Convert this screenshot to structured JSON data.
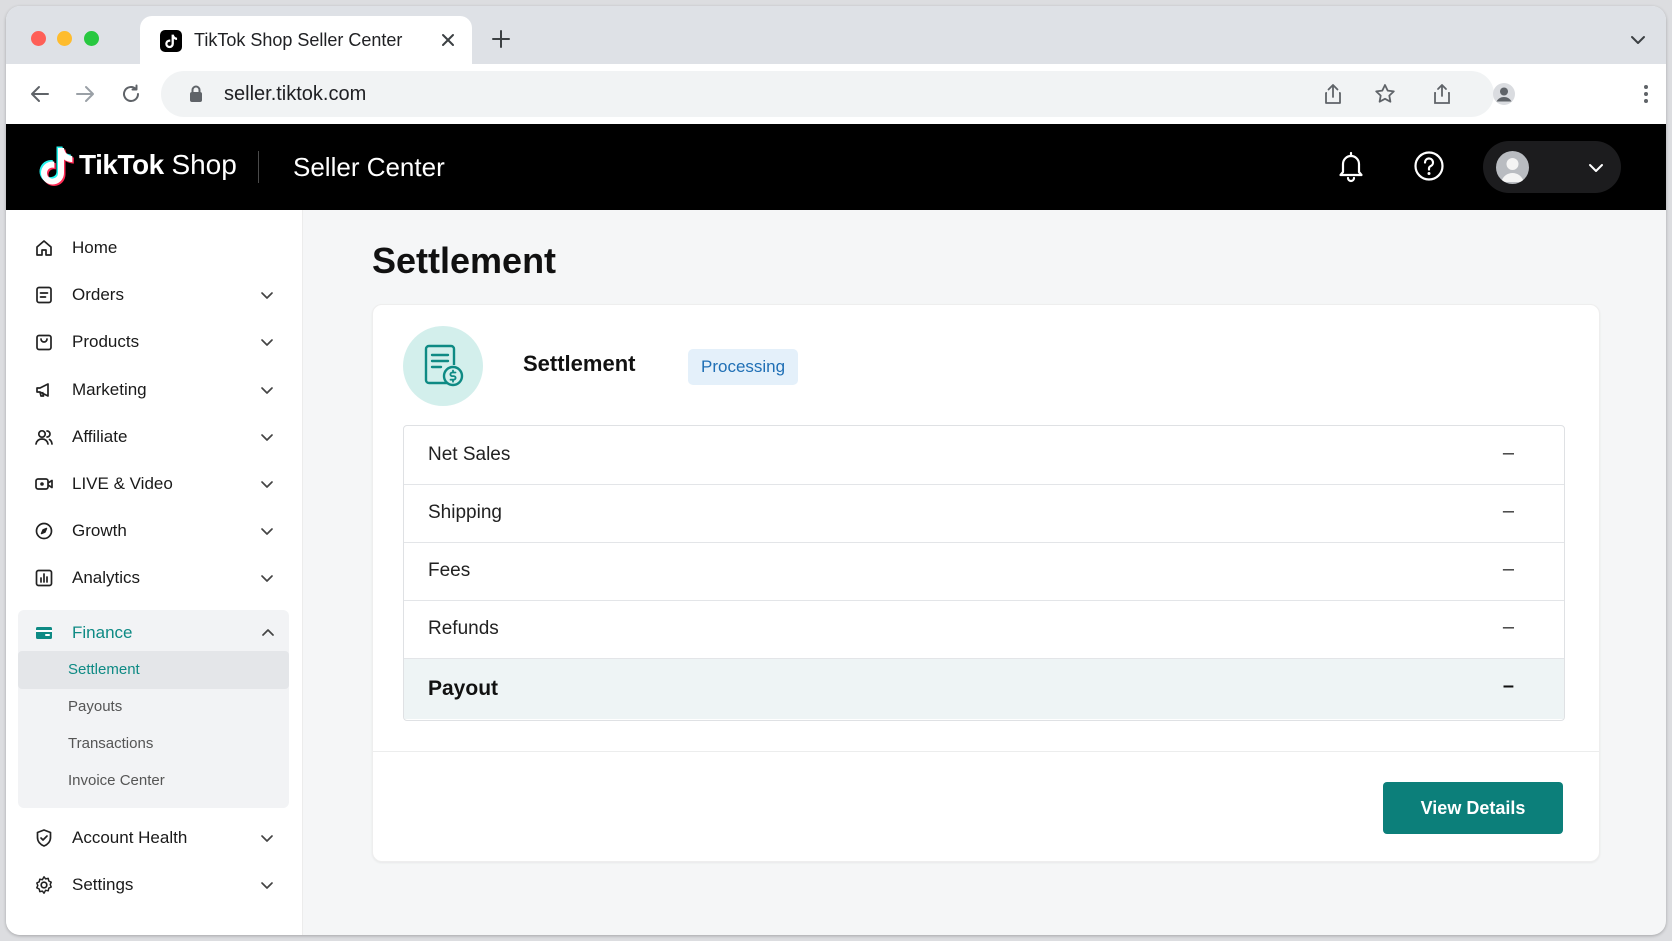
{
  "browser": {
    "tab_title": "TikTok Shop Seller Center",
    "url": "seller.tiktok.com"
  },
  "header": {
    "brand_bold": "TikTok",
    "brand_light": "Shop",
    "title": "Seller Center"
  },
  "sidebar": {
    "items": [
      {
        "label": "Home",
        "icon": "home-icon"
      },
      {
        "label": "Orders",
        "icon": "orders-icon"
      },
      {
        "label": "Products",
        "icon": "products-icon"
      },
      {
        "label": "Marketing",
        "icon": "megaphone-icon"
      },
      {
        "label": "Affiliate",
        "icon": "users-icon"
      },
      {
        "label": "LIVE & Video",
        "icon": "video-icon"
      },
      {
        "label": "Growth",
        "icon": "compass-icon"
      },
      {
        "label": "Analytics",
        "icon": "bar-chart-icon"
      }
    ],
    "finance": {
      "label": "Finance",
      "icon": "wallet-icon",
      "subitems": [
        {
          "label": "Settlement",
          "active": true
        },
        {
          "label": "Payouts",
          "active": false
        },
        {
          "label": "Transactions",
          "active": false
        },
        {
          "label": "Invoice Center",
          "active": false
        }
      ]
    },
    "bottom_items": [
      {
        "label": "Account Health",
        "icon": "shield-icon"
      },
      {
        "label": "Settings",
        "icon": "gear-icon"
      }
    ]
  },
  "main": {
    "page_title": "Settlement",
    "card": {
      "title": "Settlement",
      "status": "Processing",
      "rows": [
        {
          "label": "Net Sales",
          "value": "–"
        },
        {
          "label": "Shipping",
          "value": "–"
        },
        {
          "label": "Fees",
          "value": "–"
        },
        {
          "label": "Refunds",
          "value": "–"
        },
        {
          "label": "Payout",
          "value": "–"
        }
      ],
      "button_label": "View Details"
    }
  },
  "colors": {
    "accent": "#0e8a84",
    "button": "#0c7f7a",
    "badge_bg": "#e4f0fa",
    "badge_text": "#1f6fb5",
    "header_bg": "#000000"
  }
}
